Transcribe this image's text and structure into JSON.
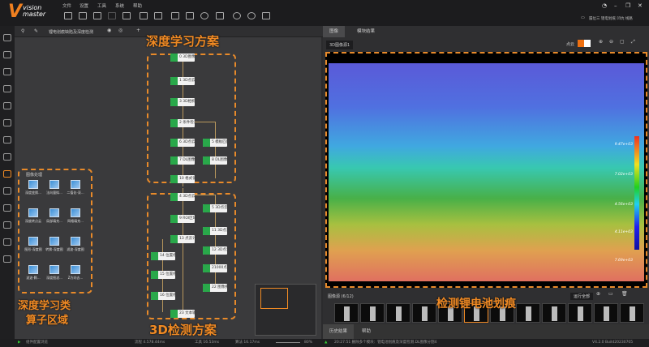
{
  "app": {
    "logo": "vision master",
    "menu": [
      "文件",
      "设置",
      "工具",
      "系统",
      "帮助"
    ],
    "solution_path": "履位三 锂电划痕 凹坑 线路"
  },
  "flow": {
    "tab_title": "锂电划痕缺陷及深度检测",
    "deep_learning_nodes": [
      "0 3D图像源1",
      "1 3D点云-深...",
      "3 3D相机-深...",
      "2 条件检测1",
      "6 3D点云分割...",
      "5 模板匹配1",
      "7 DL图像分...",
      "8 DL图像分...",
      "10 格式化输出1"
    ],
    "detection_nodes": [
      "4 3D点云转换1",
      "9 ROI区域1",
      "5 3D点云转换2",
      "11 3D点云学...",
      "13 点云计算1",
      "12 3D点云分...",
      "14 位置修正",
      "21000点云...",
      "15 位置修正",
      "22 图像拼接1",
      "16 位置修正",
      "23 文本输出1"
    ]
  },
  "palette": {
    "title": "图像处理",
    "items": [
      "深度变换...",
      "法向量拟...",
      "二值化-深...",
      "深度转点云",
      "局部填充...",
      "网格填充...",
      "图形-深度图",
      "转换-深度图",
      "滤波-深度图",
      "滤波-颗...",
      "深度图滤...",
      "Z方向去..."
    ]
  },
  "annotations": {
    "deep_learning": "深度学习方案",
    "detection_3d": "3D检测方案",
    "operator_area_1": "深度学习类",
    "operator_area_2": "算子区域",
    "scratch": "检测锂电池划痕"
  },
  "right": {
    "tabs": [
      "图像",
      "模块结果"
    ],
    "image_source": "3D图像源1",
    "point_cloud_label": "点云",
    "colorbar": [
      "9.47e+03",
      "7.02e+03",
      "4.56e+03",
      "4.11e+03",
      "7.69e+03"
    ],
    "thumbnail_header": "图像源 (6/12)",
    "run_all": "运行全部",
    "thumbnail_count": 12,
    "selected_thumbnail": 6
  },
  "bottom": {
    "tabs": [
      "历史结果",
      "帮助"
    ],
    "log": "20:27:51  删除多个模块：锂电池划痕及深度检测.DL图像分割4",
    "version": "V4.2.0 Build20230705"
  },
  "status": {
    "left": "组件配置浏览",
    "flow_time": "流程 4.578.44ms",
    "total_time": "工具 16.53ms",
    "algo_time": "算法 16.17ms",
    "zoom": "80%"
  },
  "colors": {
    "accent": "#f08a24",
    "node_icon": "#29a84a"
  }
}
